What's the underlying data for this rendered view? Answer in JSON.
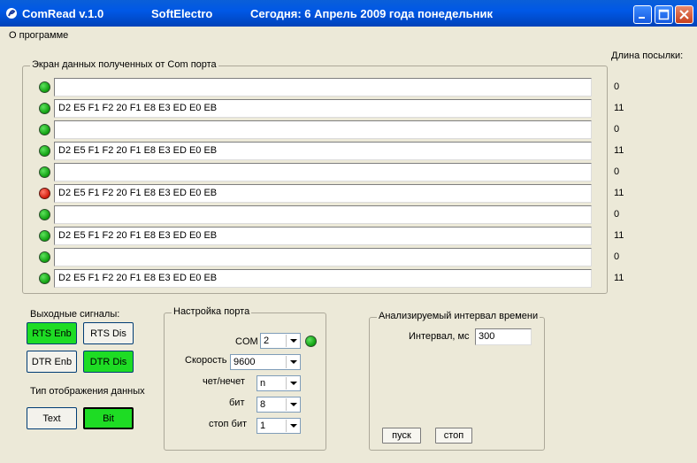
{
  "window": {
    "title": "ComRead v.1.0",
    "company": "SoftElectro",
    "date_text": "Сегодня: 6  Апрель  2009 года  понедельник"
  },
  "menu": {
    "about": "О программе"
  },
  "data_screen": {
    "title": "Экран данных полученных от Com порта",
    "length_header": "Длина посылки:",
    "rows": [
      {
        "status": "green",
        "data": "",
        "length": "0"
      },
      {
        "status": "green",
        "data": "D2 E5 F1 F2 20 F1 E8 E3 ED E0 EB",
        "length": "11"
      },
      {
        "status": "green",
        "data": "",
        "length": "0"
      },
      {
        "status": "green",
        "data": "D2 E5 F1 F2 20 F1 E8 E3 ED E0 EB",
        "length": "11"
      },
      {
        "status": "green",
        "data": "",
        "length": "0"
      },
      {
        "status": "red",
        "data": "D2 E5 F1 F2 20 F1 E8 E3 ED E0 EB",
        "length": "11"
      },
      {
        "status": "green",
        "data": "",
        "length": "0"
      },
      {
        "status": "green",
        "data": "D2 E5 F1 F2 20 F1 E8 E3 ED E0 EB",
        "length": "11"
      },
      {
        "status": "green",
        "data": "",
        "length": "0"
      },
      {
        "status": "green",
        "data": "D2 E5 F1 F2 20 F1 E8 E3 ED E0 EB",
        "length": "11"
      }
    ]
  },
  "signals": {
    "title": "Выходные сигналы:",
    "rts_enb": "RTS Enb",
    "rts_dis": "RTS Dis",
    "dtr_enb": "DTR Enb",
    "dtr_dis": "DTR Dis",
    "display_type_title": "Тип отображения данных",
    "text": "Text",
    "bit": "Bit"
  },
  "port": {
    "title": "Настройка порта",
    "com_label": "COM",
    "com_value": "2",
    "speed_label": "Скорость",
    "speed_value": "9600",
    "parity_label": "чет/нечет",
    "parity_value": "n",
    "bits_label": "бит",
    "bits_value": "8",
    "stop_label": "стоп бит",
    "stop_value": "1"
  },
  "interval": {
    "title": "Анализируемый интервал времени",
    "label": "Интервал, мс",
    "value": "300",
    "start": "пуск",
    "stop": "стоп"
  },
  "colors": {
    "led_green": "#17b317",
    "led_red": "#e02010",
    "button_active": "#1edc24",
    "titlebar": "#0058e6"
  }
}
